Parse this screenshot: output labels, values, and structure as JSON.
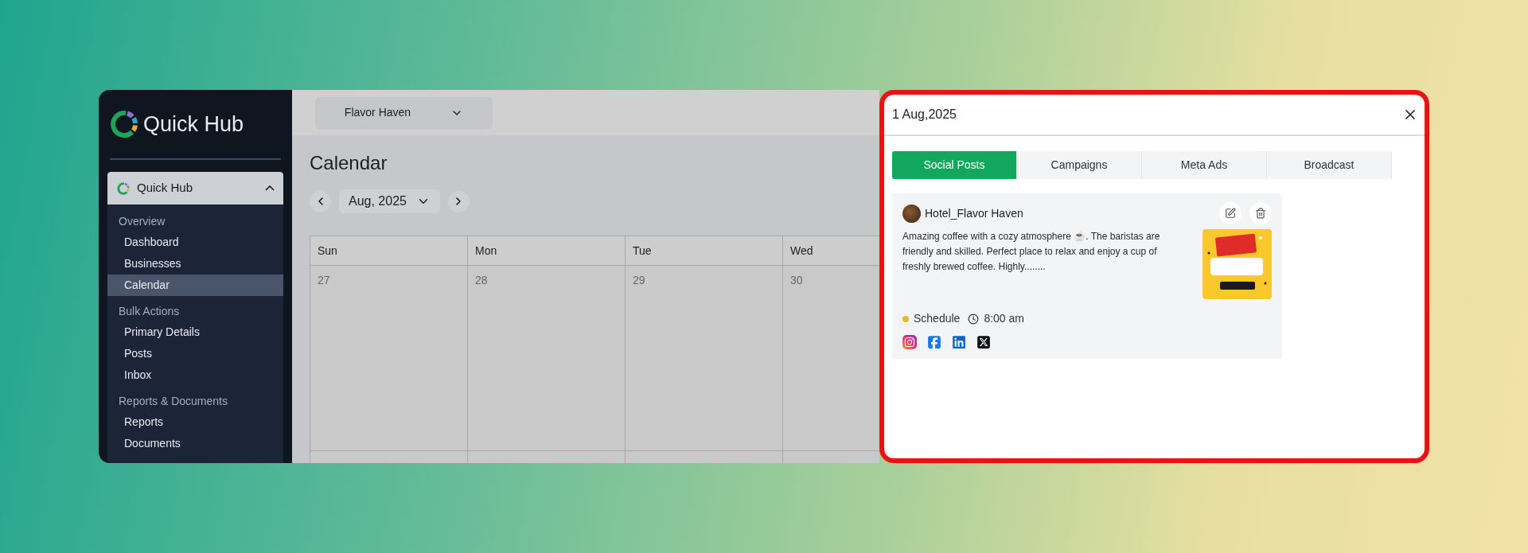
{
  "sidebar": {
    "logo_text": "Quick Hub",
    "group": {
      "label": "Quick Hub",
      "expanded": true,
      "sections": [
        {
          "title": "Overview",
          "items": [
            {
              "label": "Dashboard",
              "selected": false
            },
            {
              "label": "Businesses",
              "selected": false
            },
            {
              "label": "Calendar",
              "selected": true
            }
          ]
        },
        {
          "title": "Bulk Actions",
          "items": [
            {
              "label": "Primary Details",
              "selected": false
            },
            {
              "label": "Posts",
              "selected": false
            },
            {
              "label": "Inbox",
              "selected": false
            }
          ]
        },
        {
          "title": "Reports & Documents",
          "items": [
            {
              "label": "Reports",
              "selected": false
            },
            {
              "label": "Documents",
              "selected": false
            }
          ]
        }
      ]
    }
  },
  "topbar": {
    "business_select": "Flavor Haven"
  },
  "calendar": {
    "title": "Calendar",
    "month": "Aug, 2025",
    "weekdays": [
      "Sun",
      "Mon",
      "Tue",
      "Wed"
    ],
    "weeks": [
      [
        "27",
        "28",
        "29",
        "30"
      ]
    ]
  },
  "panel": {
    "title": "1 Aug,2025",
    "tabs": [
      {
        "label": "Social Posts",
        "selected": true
      },
      {
        "label": "Campaigns",
        "selected": false
      },
      {
        "label": "Meta Ads",
        "selected": false
      },
      {
        "label": "Broadcast",
        "selected": false
      }
    ],
    "posts": [
      {
        "author": "Hotel_Flavor Haven",
        "text": "Amazing coffee with a cozy atmosphere ☕. The baristas are friendly and skilled. Perfect place to relax and enjoy a cup of freshly brewed coffee. Highly........",
        "status": {
          "label": "Schedule",
          "color": "#f0b429"
        },
        "time": "8:00 am",
        "platforms": [
          {
            "kind": "instagram"
          },
          {
            "kind": "facebook"
          },
          {
            "kind": "linkedin"
          },
          {
            "kind": "x"
          }
        ]
      }
    ]
  }
}
